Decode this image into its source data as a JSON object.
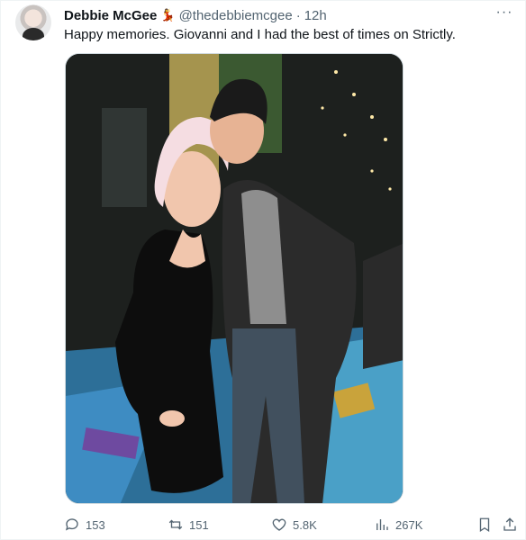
{
  "tweet": {
    "author_name": "Debbie McGee",
    "dancer_emoji": "💃",
    "handle": "@thedebbiemcgee",
    "separator": "·",
    "time": "12h",
    "more_label": "···",
    "text": "Happy memories. Giovanni and I had the best of times on Strictly.",
    "icons": {
      "avatar": "profile-avatar",
      "more": "more-options-icon"
    }
  },
  "actions": {
    "replies": "153",
    "retweets": "151",
    "likes": "5.8K",
    "views": "267K",
    "icons": [
      "reply-icon",
      "retweet-icon",
      "like-icon",
      "views-icon",
      "bookmark-icon",
      "share-icon"
    ]
  },
  "colors": {
    "text": "#0f1419",
    "secondary": "#536471",
    "border": "#eff3f4"
  }
}
